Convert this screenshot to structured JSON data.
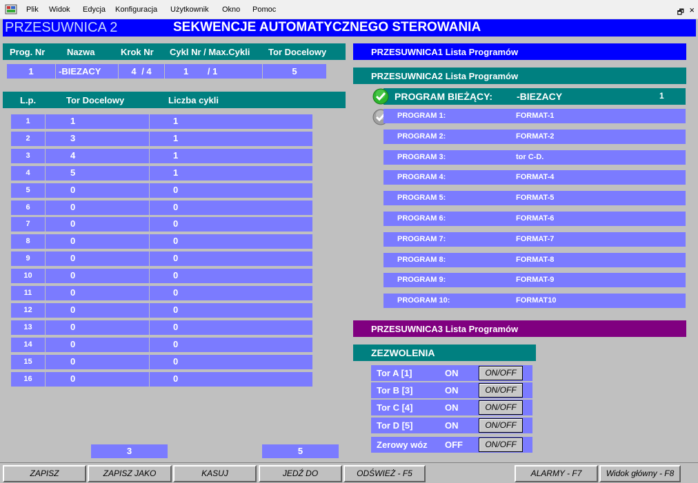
{
  "menubar": {
    "items": [
      "Plik",
      "Widok",
      "Edycja",
      "Konfiguracja",
      "Użytkownik",
      "Okno",
      "Pomoc"
    ],
    "restore_glyph": "🗗",
    "close_glyph": "×"
  },
  "title": {
    "left": "PRZESUWNICA 2",
    "main": "SEKWENCJE AUTOMATYCZNEGO STEROWANIA"
  },
  "status": {
    "headers": [
      "Prog. Nr",
      "Nazwa",
      "Krok Nr",
      "Cykl Nr / Max.Cykli",
      "Tor Docelowy"
    ],
    "prog_nr": "1",
    "nazwa": "-BIEZACY",
    "krok": "4",
    "krok_max": "/ 4",
    "cykl": "1",
    "cykl_max": "/ 1",
    "tor": "5"
  },
  "sequence": {
    "headers": [
      "L.p.",
      "Tor Docelowy",
      "Liczba cykli"
    ],
    "rows": [
      {
        "lp": "1",
        "tor": "1",
        "cykli": "1"
      },
      {
        "lp": "2",
        "tor": "3",
        "cykli": "1"
      },
      {
        "lp": "3",
        "tor": "4",
        "cykli": "1"
      },
      {
        "lp": "4",
        "tor": "5",
        "cykli": "1"
      },
      {
        "lp": "5",
        "tor": "0",
        "cykli": "0"
      },
      {
        "lp": "6",
        "tor": "0",
        "cykli": "0"
      },
      {
        "lp": "7",
        "tor": "0",
        "cykli": "0"
      },
      {
        "lp": "8",
        "tor": "0",
        "cykli": "0"
      },
      {
        "lp": "9",
        "tor": "0",
        "cykli": "0"
      },
      {
        "lp": "10",
        "tor": "0",
        "cykli": "0"
      },
      {
        "lp": "11",
        "tor": "0",
        "cykli": "0"
      },
      {
        "lp": "12",
        "tor": "0",
        "cykli": "0"
      },
      {
        "lp": "13",
        "tor": "0",
        "cykli": "0"
      },
      {
        "lp": "14",
        "tor": "0",
        "cykli": "0"
      },
      {
        "lp": "15",
        "tor": "0",
        "cykli": "0"
      },
      {
        "lp": "16",
        "tor": "0",
        "cykli": "0"
      }
    ],
    "bottom_left": "3",
    "bottom_right": "5"
  },
  "programs": {
    "p1_header": "PRZESUWNICA1  Lista Programów",
    "p2_header": "PRZESUWNICA2  Lista Programów",
    "p3_header": "PRZESUWNICA3  Lista Programów",
    "current_label": "PROGRAM BIEŻĄCY:",
    "current_value": "-BIEZACY",
    "current_number": "1",
    "list": [
      {
        "label": "PROGRAM 1:",
        "value": "FORMAT-1"
      },
      {
        "label": "PROGRAM 2:",
        "value": "FORMAT-2"
      },
      {
        "label": "PROGRAM 3:",
        "value": "tor C-D."
      },
      {
        "label": "PROGRAM 4:",
        "value": "FORMAT-4"
      },
      {
        "label": "PROGRAM 5:",
        "value": "FORMAT-5"
      },
      {
        "label": "PROGRAM 6:",
        "value": "FORMAT-6"
      },
      {
        "label": "PROGRAM 7:",
        "value": "FORMAT-7"
      },
      {
        "label": "PROGRAM 8:",
        "value": "FORMAT-8"
      },
      {
        "label": "PROGRAM 9:",
        "value": "FORMAT-9"
      },
      {
        "label": "PROGRAM 10:",
        "value": "FORMAT10"
      }
    ]
  },
  "permissions": {
    "header": "ZEZWOLENIA",
    "items": [
      {
        "name": "Tor A  [1]",
        "state": "ON",
        "button": "ON/OFF"
      },
      {
        "name": "Tor B  [3]",
        "state": "ON",
        "button": "ON/OFF"
      },
      {
        "name": "Tor C  [4]",
        "state": "ON",
        "button": "ON/OFF"
      },
      {
        "name": "Tor D  [5]",
        "state": "ON",
        "button": "ON/OFF"
      },
      {
        "name": "Zerowy wóz",
        "state": "OFF",
        "button": "ON/OFF"
      }
    ]
  },
  "buttons": {
    "zapisz": "ZAPISZ",
    "zapisz_jako": "ZAPISZ JAKO",
    "kasuj": "KASUJ",
    "jedz_do": "JEDŹ DO",
    "odswiez": "ODŚWIEŻ - F5",
    "alarmy": "ALARMY - F7",
    "widok": "Widok główny - F8"
  },
  "colors": {
    "title_bar": "#0000ff",
    "teal_header": "#008080",
    "cell_blue": "#7b7bff",
    "p1_header": "#0000ff",
    "p3_header": "#800080",
    "check_green": "#2db52d",
    "check_grey": "#a0a0a0",
    "background": "#c0c0c0"
  }
}
